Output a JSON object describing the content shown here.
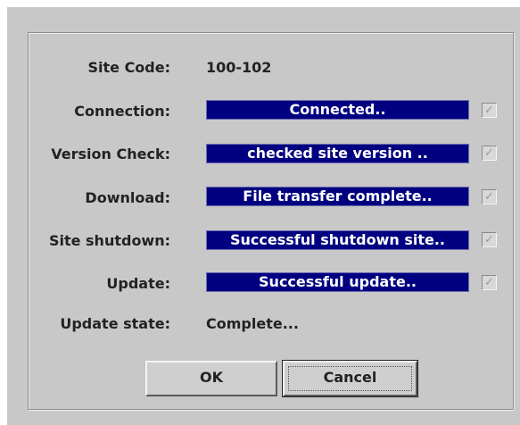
{
  "dialog": {
    "site_code": {
      "label": "Site Code:",
      "value": "100-102"
    },
    "rows": [
      {
        "label": "Connection:",
        "status": "Connected..",
        "checked": true
      },
      {
        "label": "Version Check:",
        "status": "checked site version ..",
        "checked": true
      },
      {
        "label": "Download:",
        "status": "File transfer complete..",
        "checked": true
      },
      {
        "label": "Site shutdown:",
        "status": "Successful shutdown site..",
        "checked": true
      },
      {
        "label": "Update:",
        "status": "Successful update..",
        "checked": true
      }
    ],
    "update_state": {
      "label": "Update state:",
      "value": "Complete..."
    },
    "buttons": {
      "ok": "OK",
      "cancel": "Cancel"
    },
    "check_mark": "✓"
  },
  "colors": {
    "dialog_background": "#c8c8c8",
    "status_bar": "#000080",
    "status_text": "#ffffff"
  }
}
